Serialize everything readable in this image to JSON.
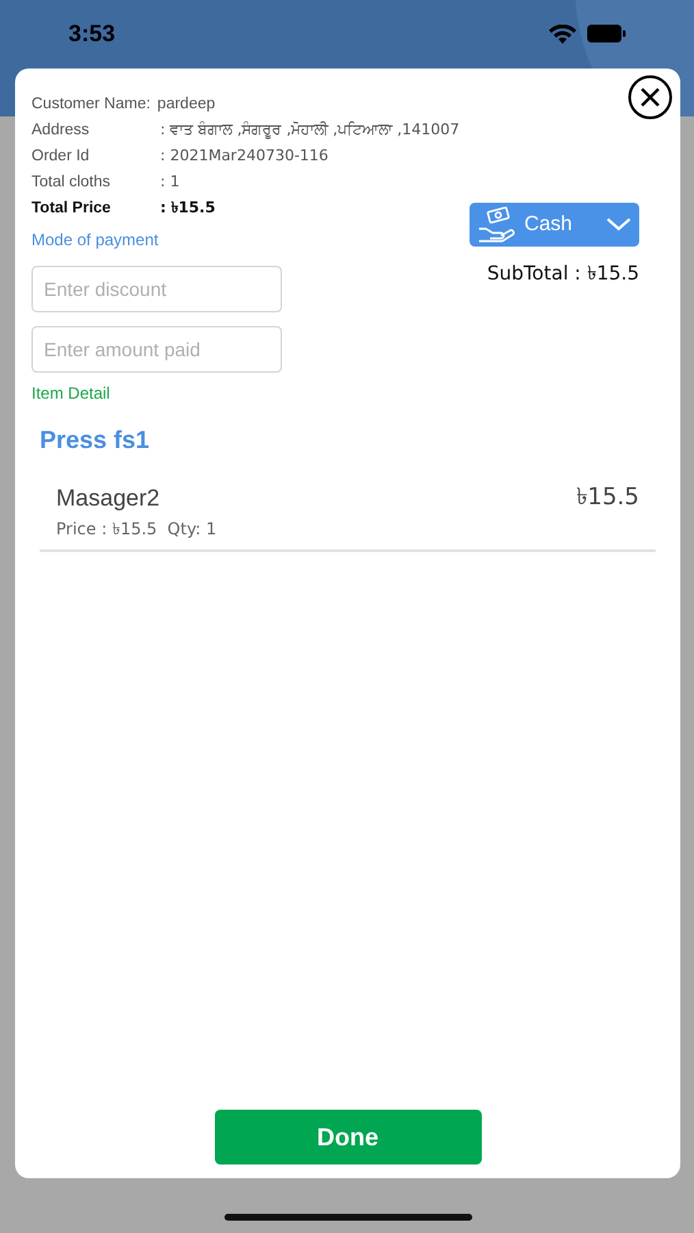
{
  "status_bar": {
    "time": "3:53"
  },
  "details": [
    {
      "kind": "inline",
      "label": "Customer Name:",
      "value": "pardeep",
      "bold": false
    },
    {
      "kind": "aligned",
      "label": "Address",
      "value": ": ਵਾਤ ਬੰਗਾਲ ,ਸੰਗਰੂਰ ,ਮੋਹਾਲੀ ,ਪਟਿਆਲਾ ,141007",
      "bold": false
    },
    {
      "kind": "aligned",
      "label": "Order Id",
      "value": ": 2021Mar240730-116",
      "bold": false
    },
    {
      "kind": "aligned",
      "label": "Total cloths",
      "value": ": 1",
      "bold": false
    },
    {
      "kind": "aligned",
      "label": "Total Price",
      "value": ": ৳15.5",
      "bold": true
    }
  ],
  "mode_label": "Mode of payment",
  "payment_dropdown": {
    "value": "Cash"
  },
  "subtotal": "SubTotal : ৳15.5",
  "discount_field": {
    "placeholder": "Enter discount"
  },
  "amount_field": {
    "placeholder": "Enter amount paid"
  },
  "item_detail_label": "Item Detail",
  "shop_name": "Press fs1",
  "items": [
    {
      "name": "Masager2",
      "detail": "Price : ৳15.5  Qty: 1",
      "total": "৳15.5"
    }
  ],
  "done_button": "Done"
}
